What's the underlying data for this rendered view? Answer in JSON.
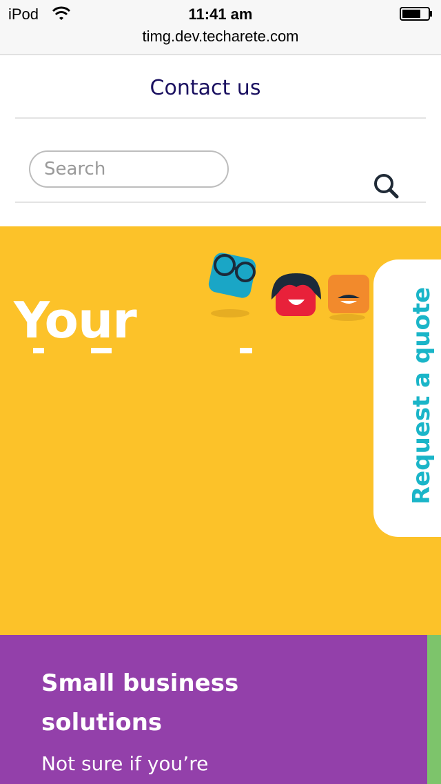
{
  "status_bar": {
    "carrier": "iPod",
    "time": "11:41 am",
    "url": "timg.dev.techarete.com"
  },
  "nav": {
    "contact_label": "Contact us"
  },
  "search": {
    "placeholder": "Search"
  },
  "hero": {
    "title": "Your"
  },
  "quote_tab": {
    "label": "Request a quote"
  },
  "section": {
    "heading": "Small business solutions",
    "body": "Not sure if you’re"
  },
  "colors": {
    "hero_bg": "#fcc229",
    "purple_bg": "#9340aa",
    "green_strip": "#7dc46b",
    "quote_text": "#1ab5c8",
    "nav_text": "#1a1060"
  },
  "icons": {
    "wifi": "wifi-icon",
    "battery": "battery-icon",
    "search": "search-icon"
  }
}
